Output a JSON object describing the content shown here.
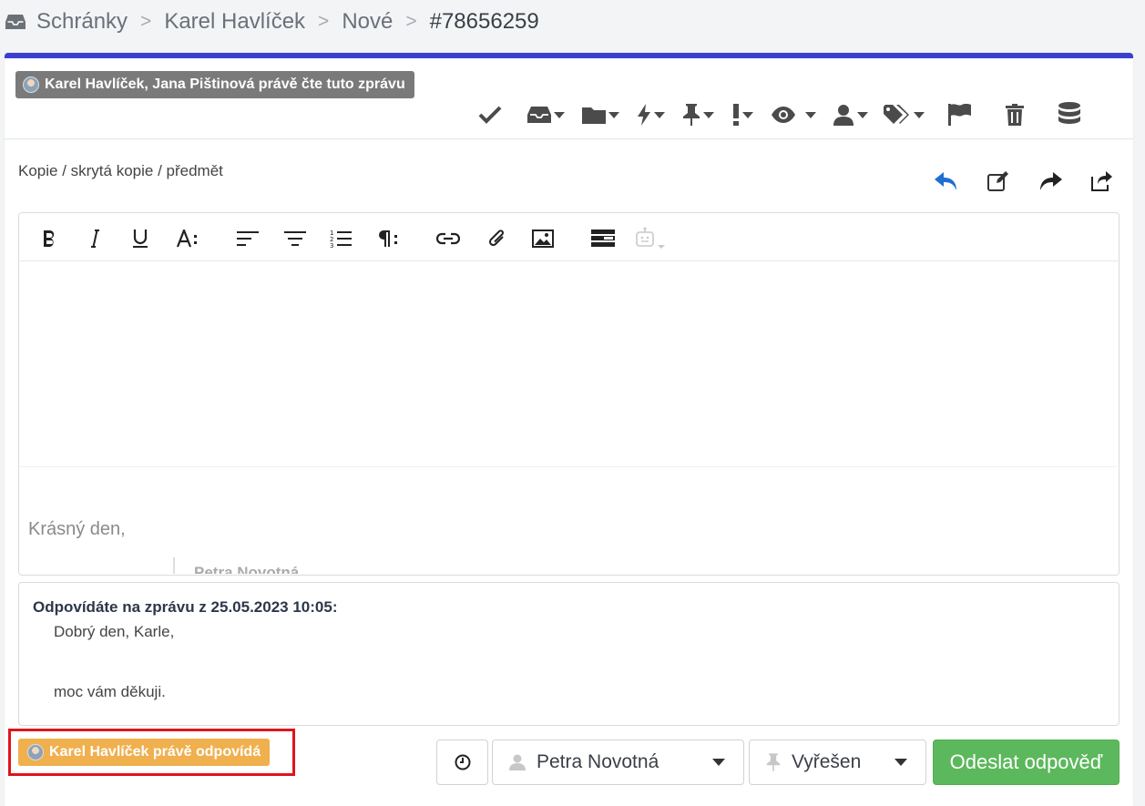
{
  "breadcrumb": {
    "items": [
      "Schránky",
      "Karel Havlíček",
      "Nové",
      "#78656259"
    ],
    "separator": ">"
  },
  "presence": {
    "reading_text": "Karel Havlíček, Jana Pištinová právě čte tuto zprávu",
    "answering_text": "Karel Havlíček právě odpovídá"
  },
  "toolbar": {
    "icons": [
      "check-icon",
      "inbox-icon",
      "folder-icon",
      "bolt-icon",
      "pin-icon",
      "exclamation-icon",
      "eye-icon",
      "user-icon",
      "tags-icon",
      "flag-icon",
      "trash-icon",
      "database-icon"
    ]
  },
  "compose": {
    "copy_link": "Kopie / skrytá kopie / předmět",
    "greeting": "Krásný den,",
    "quoted_name": "Petra Novotná"
  },
  "reply_context": {
    "title": "Odpovídáte na zprávu z 25.05.2023 10:05:",
    "line1": "Dobrý den, Karle,",
    "line2": "moc vám děkuji."
  },
  "footer": {
    "assignee": "Petra Novotná",
    "status": "Vyřešen",
    "send_label": "Odeslat odpověď"
  },
  "colors": {
    "accent_bar": "#3b3fd0",
    "send_button": "#5cb85c",
    "answering_badge": "#f0b04e",
    "reading_badge": "#7a7a7a",
    "reply_icon": "#1f6fd1",
    "highlight": "#e0141b"
  }
}
